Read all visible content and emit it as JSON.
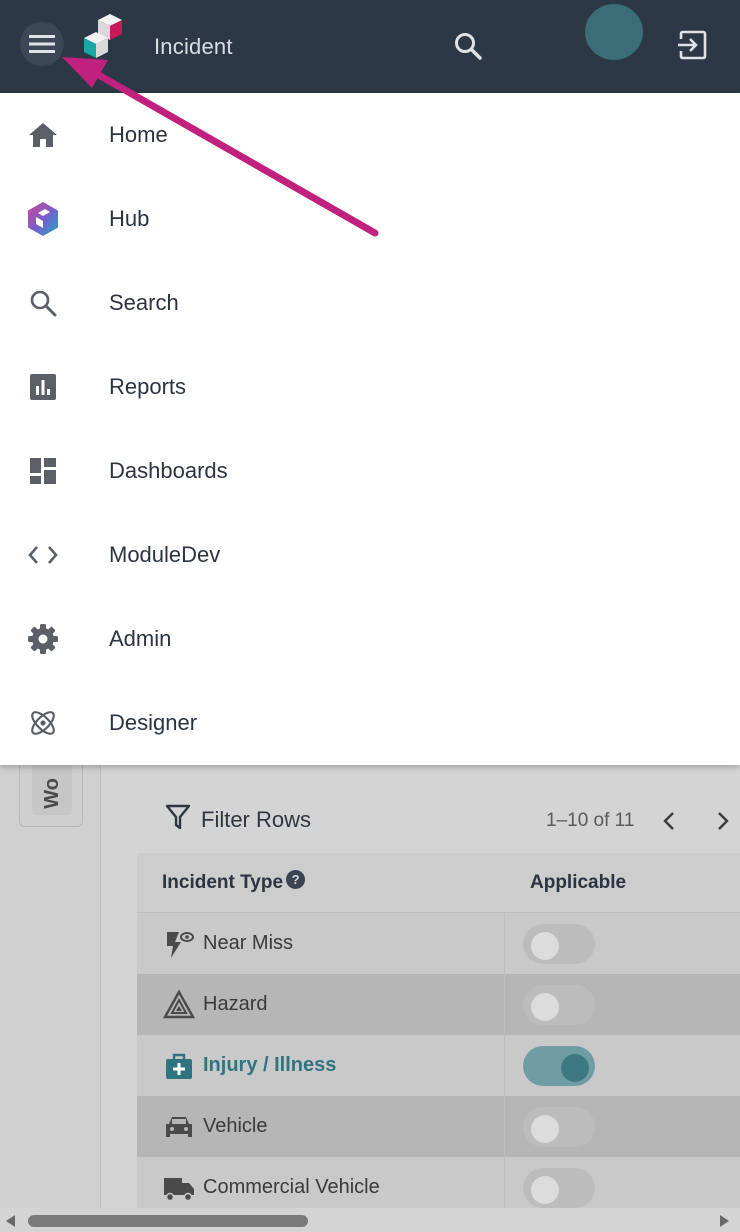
{
  "app_bar": {
    "title": "Incident",
    "menu_icon": "hamburger-menu-icon",
    "search_icon": "search-icon",
    "logout_icon": "logout-icon"
  },
  "nav_drawer": {
    "items": [
      {
        "label": "Home",
        "icon": "home-icon"
      },
      {
        "label": "Hub",
        "icon": "hub-icon"
      },
      {
        "label": "Search",
        "icon": "search-icon"
      },
      {
        "label": "Reports",
        "icon": "reports-icon"
      },
      {
        "label": "Dashboards",
        "icon": "dashboards-icon"
      },
      {
        "label": "ModuleDev",
        "icon": "code-icon"
      },
      {
        "label": "Admin",
        "icon": "gear-icon"
      },
      {
        "label": "Designer",
        "icon": "atom-icon"
      }
    ]
  },
  "background_page": {
    "rail_tab_text": "Wo",
    "filter_label": "Filter Rows",
    "pagination": "1–10 of 11",
    "table": {
      "headers": {
        "type": "Incident Type",
        "applicable": "Applicable",
        "help": "?"
      },
      "rows": [
        {
          "label": "Near Miss",
          "icon": "near-miss-icon",
          "applicable": false
        },
        {
          "label": "Hazard",
          "icon": "hazard-icon",
          "applicable": false
        },
        {
          "label": "Injury / Illness",
          "icon": "medical-bag-icon",
          "applicable": true
        },
        {
          "label": "Vehicle",
          "icon": "car-icon",
          "applicable": false
        },
        {
          "label": "Commercial Vehicle",
          "icon": "truck-icon",
          "applicable": false
        }
      ]
    }
  },
  "colors": {
    "app_bar": "#2c3845",
    "accent_teal": "#3d7983",
    "annotation_arrow": "#c0207e"
  }
}
